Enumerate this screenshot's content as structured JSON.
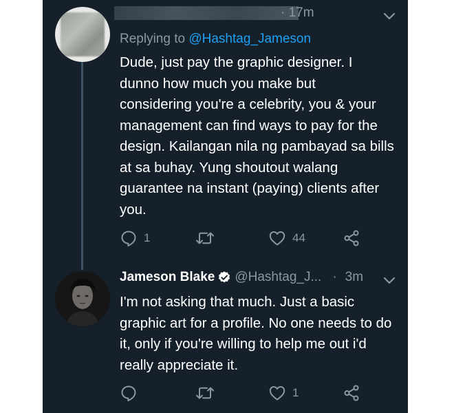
{
  "tweet1": {
    "timestamp": "· 17m",
    "replying_prefix": "Replying to ",
    "replying_handle": "@Hashtag_Jameson",
    "text": "Dude, just pay the graphic designer. I\ndunno how much you make but\nconsidering you're a celebrity, you & your\nmanagement can find ways to pay for the\ndesign. Kailangan nila ng pambayad sa bills\nat sa buhay. Yung shoutout walang\nguarantee na instant (paying) clients after\nyou.",
    "reply_count": "1",
    "retweet_count": "",
    "like_count": "44"
  },
  "tweet2": {
    "name": "Jameson Blake",
    "handle": "@Hashtag_J...",
    "timestamp": "3m",
    "text": "I'm not asking that much. Just a basic\ngraphic art for a profile. No one needs to do\nit, only if you're willing to help me out i'd\nreally appreciate it.",
    "reply_count": "",
    "retweet_count": "",
    "like_count": "1"
  },
  "icons": {
    "reply": "reply-icon",
    "retweet": "retweet-icon",
    "like": "heart-icon",
    "share": "share-icon",
    "more": "chevron-down-icon",
    "verified": "verified-badge-icon"
  },
  "colors": {
    "background": "#15202b",
    "text": "#ffffff",
    "secondary": "#8899a6",
    "link": "#1da1f2",
    "thread_line": "#3d5466"
  }
}
